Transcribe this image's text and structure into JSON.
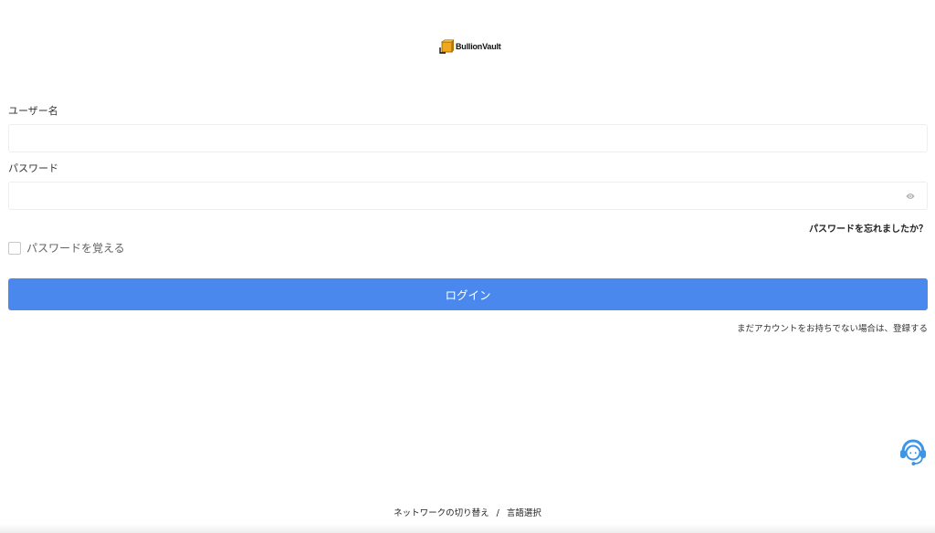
{
  "brand": {
    "name": "BullionVault",
    "accent_color": "#f2a81d"
  },
  "form": {
    "username_label": "ユーザー名",
    "username_value": "",
    "password_label": "パスワード",
    "password_value": "",
    "forgot_password": "パスワードを忘れましたか？",
    "remember_me": "パスワードを覚える",
    "login_button": "ログイン",
    "login_button_color": "#4a88ee",
    "register_prompt": "まだアカウントをお持ちでない場合は、",
    "register_link": "登録する"
  },
  "icons": {
    "password_toggle": "eye-icon",
    "support": "headset-support-icon",
    "support_color": "#3d95e6"
  },
  "footer": {
    "switch_network": "ネットワークの切り替え",
    "separator": "/",
    "language_select": "言語選択"
  }
}
